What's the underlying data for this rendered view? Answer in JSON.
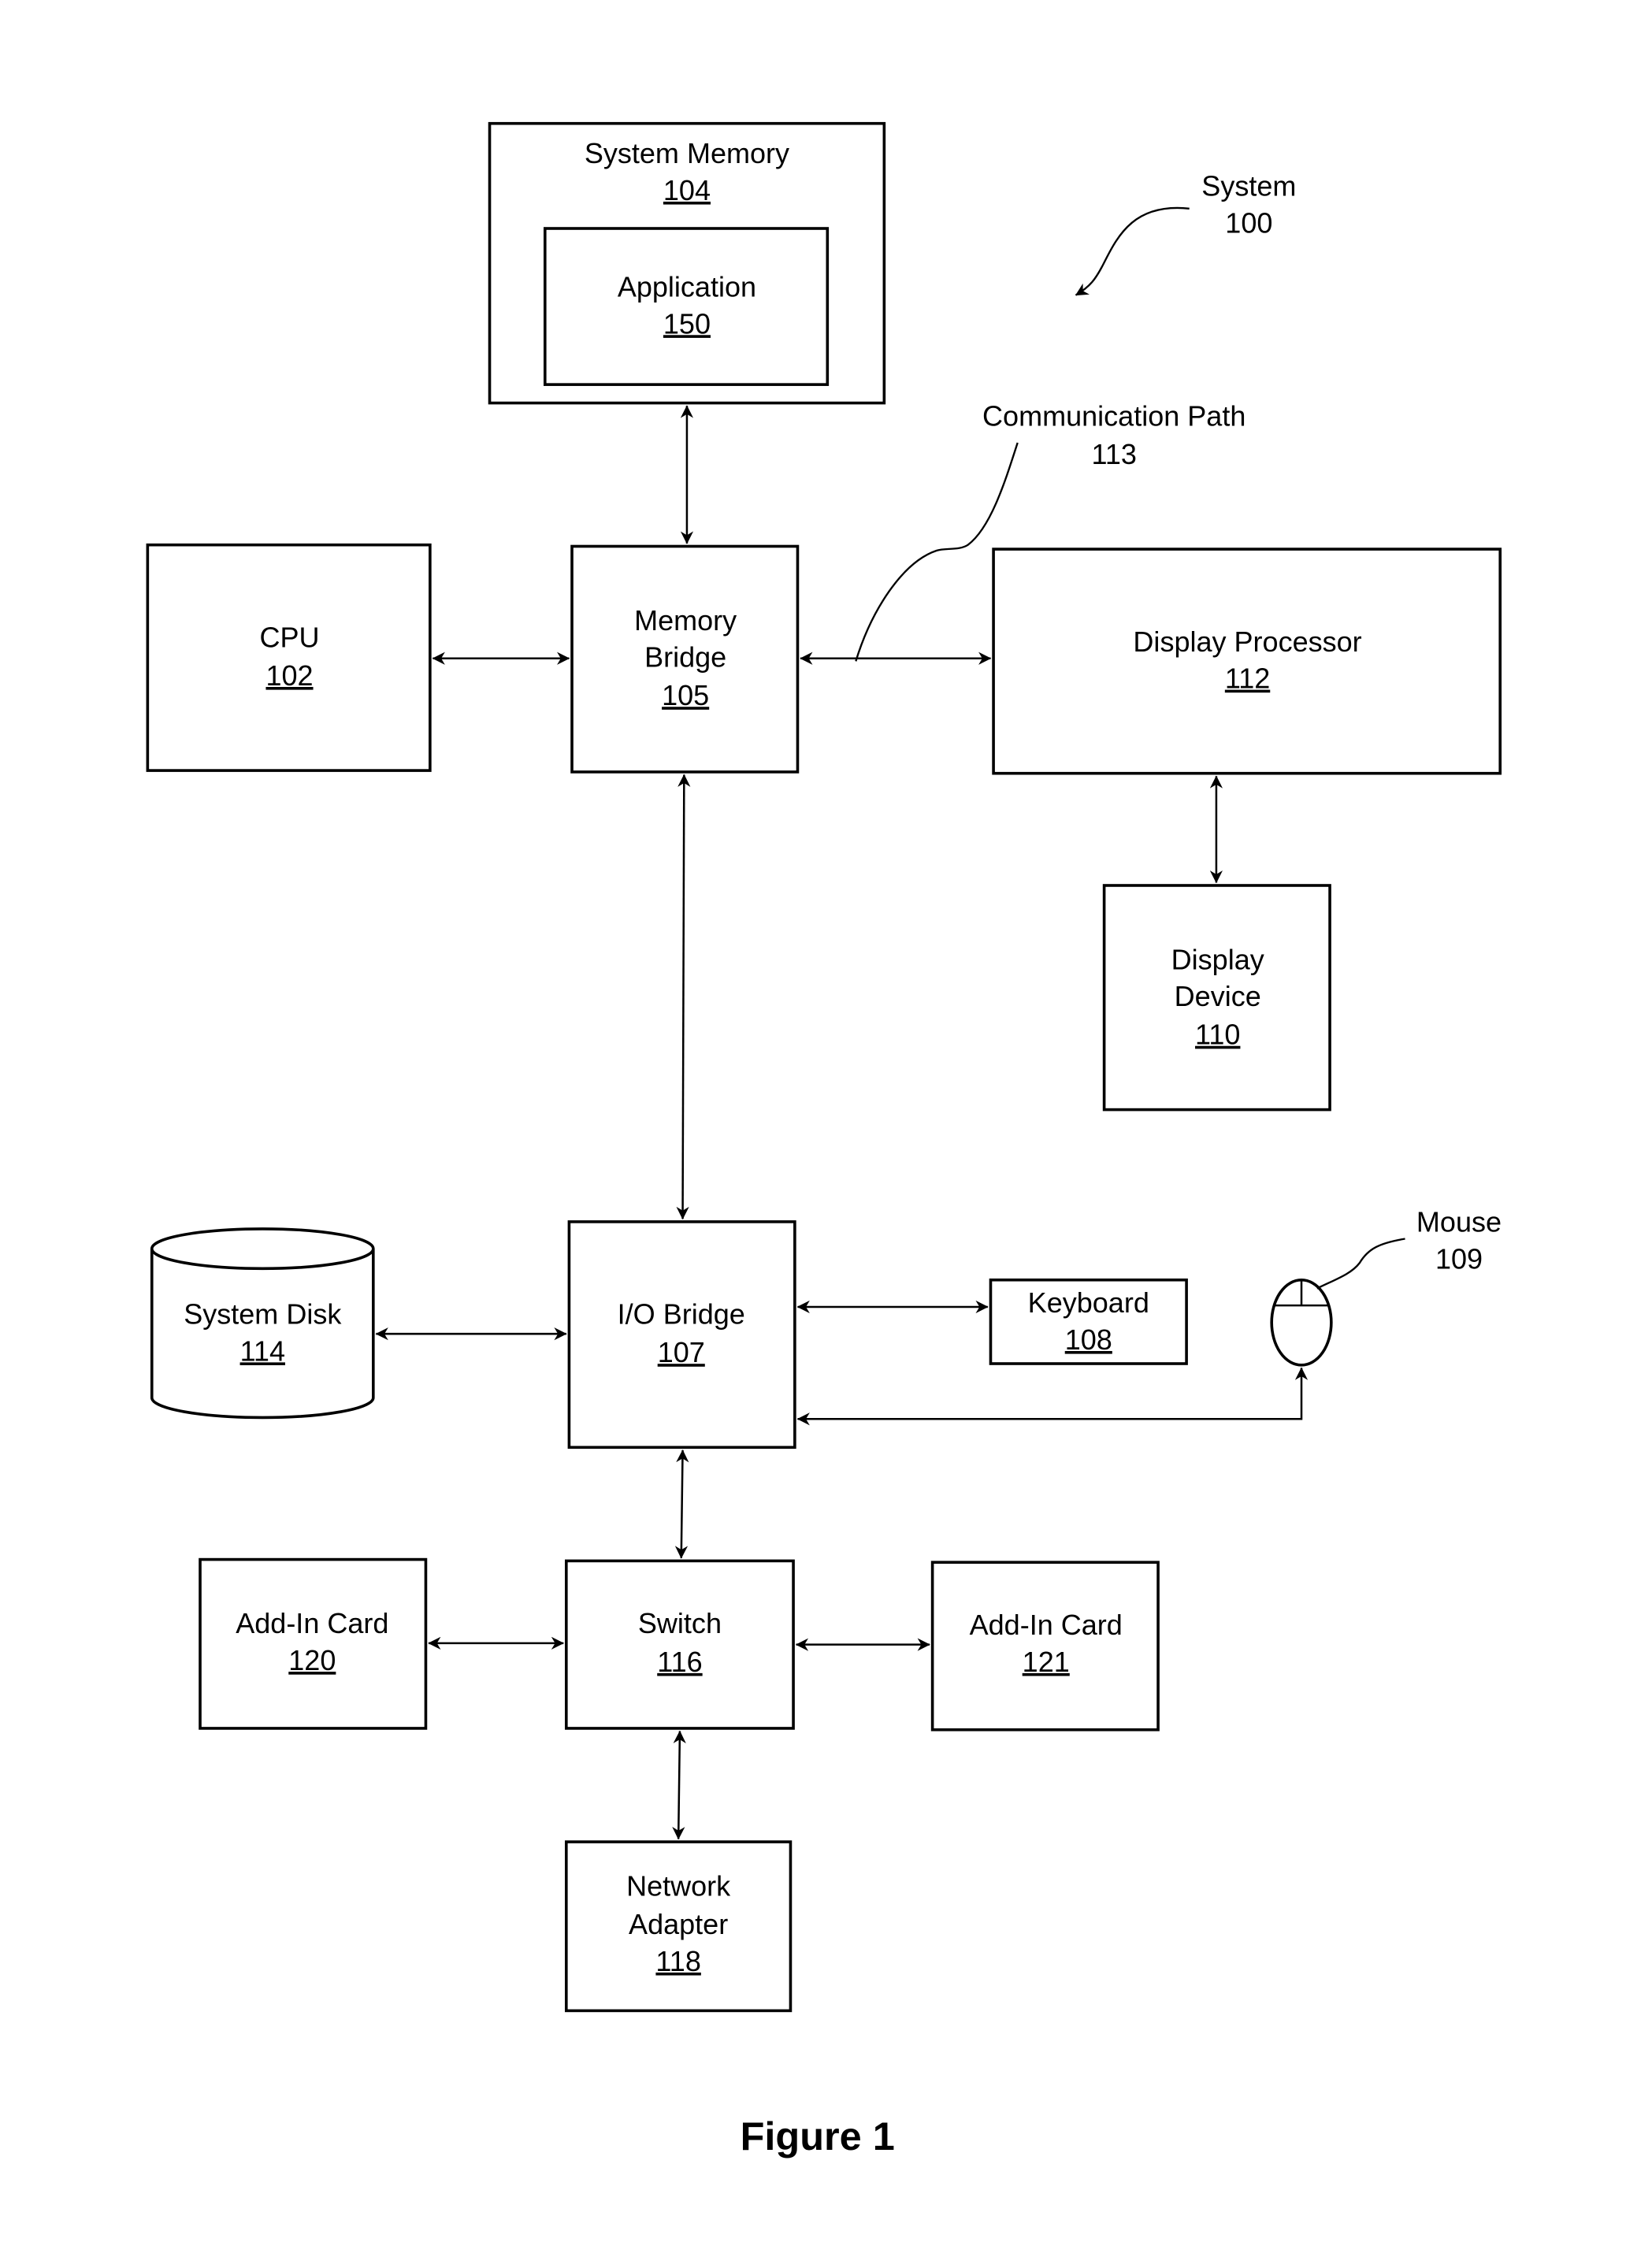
{
  "figure": {
    "caption": "Figure 1",
    "system_label": "System",
    "system_ref": "100"
  },
  "components": {
    "system_memory": {
      "label": "System Memory",
      "ref": "104"
    },
    "application": {
      "label": "Application",
      "ref": "150"
    },
    "cpu": {
      "label": "CPU",
      "ref": "102"
    },
    "memory_bridge": {
      "label_line1": "Memory",
      "label_line2": "Bridge",
      "ref": "105"
    },
    "display_processor": {
      "label": "Display Processor",
      "ref": "112"
    },
    "display_device": {
      "label_line1": "Display",
      "label_line2": "Device",
      "ref": "110"
    },
    "communication_path": {
      "label": "Communication Path",
      "ref": "113"
    },
    "system_disk": {
      "label": "System Disk",
      "ref": "114"
    },
    "io_bridge": {
      "label": "I/O Bridge",
      "ref": "107"
    },
    "keyboard": {
      "label": "Keyboard",
      "ref": "108"
    },
    "mouse": {
      "label": "Mouse",
      "ref": "109"
    },
    "add_in_card_120": {
      "label": "Add-In Card",
      "ref": "120"
    },
    "switch": {
      "label": "Switch",
      "ref": "116"
    },
    "add_in_card_121": {
      "label": "Add-In Card",
      "ref": "121"
    },
    "network_adapter": {
      "label_line1": "Network",
      "label_line2": "Adapter",
      "ref": "118"
    }
  },
  "connections": [
    {
      "from": "System Memory 104",
      "to": "Memory Bridge 105",
      "type": "bidirectional"
    },
    {
      "from": "CPU 102",
      "to": "Memory Bridge 105",
      "type": "bidirectional"
    },
    {
      "from": "Memory Bridge 105",
      "to": "Display Processor 112",
      "type": "bidirectional",
      "via": "Communication Path 113"
    },
    {
      "from": "Display Processor 112",
      "to": "Display Device 110",
      "type": "bidirectional"
    },
    {
      "from": "Memory Bridge 105",
      "to": "I/O Bridge 107",
      "type": "bidirectional"
    },
    {
      "from": "System Disk 114",
      "to": "I/O Bridge 107",
      "type": "bidirectional"
    },
    {
      "from": "I/O Bridge 107",
      "to": "Keyboard 108",
      "type": "bidirectional"
    },
    {
      "from": "Mouse 109",
      "to": "I/O Bridge 107",
      "type": "bidirectional"
    },
    {
      "from": "I/O Bridge 107",
      "to": "Switch 116",
      "type": "bidirectional"
    },
    {
      "from": "Add-In Card 120",
      "to": "Switch 116",
      "type": "bidirectional"
    },
    {
      "from": "Switch 116",
      "to": "Add-In Card 121",
      "type": "bidirectional"
    },
    {
      "from": "Switch 116",
      "to": "Network Adapter 118",
      "type": "bidirectional"
    }
  ]
}
